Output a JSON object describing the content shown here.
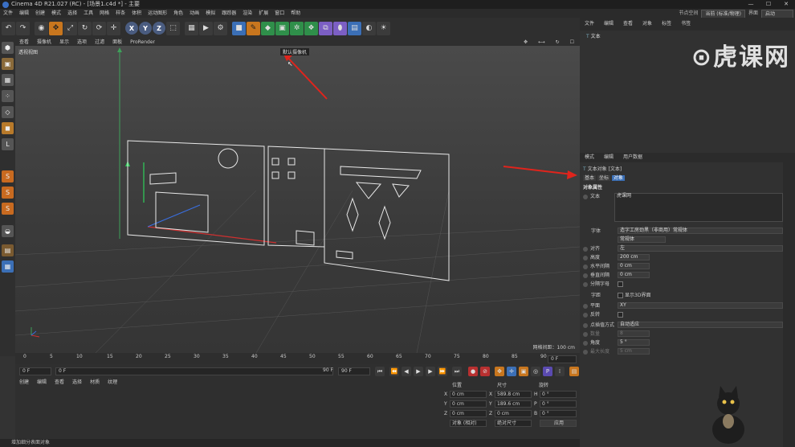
{
  "window": {
    "title": "Cinema 4D R21.027 (RC) - [场景1.c4d *] - 主要",
    "controls": [
      "—",
      "☐",
      "✕"
    ]
  },
  "menubar": [
    "文件",
    "编辑",
    "创建",
    "模式",
    "选择",
    "工具",
    "网格",
    "样条",
    "体积",
    "运动图形",
    "角色",
    "动画",
    "模拟",
    "跟踪器",
    "渲染",
    "扩展",
    "窗口",
    "帮助"
  ],
  "layout": {
    "label": "节点空间",
    "node_value": "当前 (标准/物理)",
    "interface_label": "界面",
    "interface_value": "启动"
  },
  "toolbar": {
    "icons": [
      "undo-icon",
      "redo-icon",
      "live-select-icon",
      "move-icon",
      "scale-icon",
      "rotate-icon",
      "recent-icon",
      "axis-icon",
      "x-axis-icon",
      "y-axis-icon",
      "z-axis-icon",
      "coord-system-icon",
      "render-view-icon",
      "render-icon",
      "render-settings-icon",
      "cube-icon",
      "pen-icon",
      "subdivision-icon",
      "extrude-icon",
      "cloner-icon",
      "mograph-icon",
      "deformer-icon",
      "tag-icon",
      "floor-icon",
      "camera-icon",
      "light-icon"
    ],
    "xyz": [
      "X",
      "Y",
      "Z"
    ]
  },
  "viewport": {
    "menu": [
      "查看",
      "摄像机",
      "显示",
      "选项",
      "过滤",
      "面板",
      "ProRender"
    ],
    "label": "透视视图",
    "camera_tip": "默认摄像机",
    "grid_info": "网格间距：100 cm"
  },
  "timeline": {
    "ticks": [
      "0",
      "5",
      "10",
      "15",
      "20",
      "25",
      "30",
      "35",
      "40",
      "45",
      "50",
      "55",
      "60",
      "65",
      "70",
      "75",
      "80",
      "85",
      "90"
    ],
    "end_label": "0 F"
  },
  "playback": {
    "start": "0 F",
    "current": "0 F",
    "range_end": "90 F",
    "end": "90 F"
  },
  "materials": {
    "menu": [
      "创建",
      "编辑",
      "查看",
      "选择",
      "材质",
      "纹理"
    ]
  },
  "coordinates": {
    "headers": [
      "位置",
      "尺寸",
      "旋转"
    ],
    "rows": [
      {
        "axis": "X",
        "pos": "0 cm",
        "size_axis": "X",
        "size": "589.8 cm",
        "rot_axis": "H",
        "rot": "0 °"
      },
      {
        "axis": "Y",
        "pos": "0 cm",
        "size_axis": "Y",
        "size": "189.6 cm",
        "rot_axis": "P",
        "rot": "0 °"
      },
      {
        "axis": "Z",
        "pos": "0 cm",
        "size_axis": "Z",
        "size": "0 cm",
        "rot_axis": "B",
        "rot": "0 °"
      }
    ],
    "mode": "对象 (相对)",
    "size_mode": "绝对尺寸",
    "apply": "应用"
  },
  "status": "增加细分表面对象",
  "objects": {
    "tabs": [
      "文件",
      "编辑",
      "查看",
      "对象",
      "标签",
      "书签"
    ],
    "item": "文本"
  },
  "attributes": {
    "menu": [
      "模式",
      "编辑",
      "用户数据"
    ],
    "object_title": "文本对象 [文本]",
    "tabs": [
      "基本",
      "坐标",
      "对象"
    ],
    "section": "对象属性",
    "text_label": "文本",
    "text_value": "虎课网",
    "font_label": "字体",
    "font_value": "造字工房劲黑（非商用）常规体",
    "font_style": "常规体",
    "align_label": "对齐",
    "align_value": "左",
    "height_label": "高度",
    "height_value": "200 cm",
    "hspace_label": "水平间隔",
    "hspace_value": "0 cm",
    "vspace_label": "垂直间隔",
    "vspace_value": "0 cm",
    "kerning_label": "分隔字母",
    "glyph_label": "字距",
    "show3d_label": "显示3D界面",
    "plane_label": "平面",
    "plane_value": "XY",
    "reverse_label": "反转",
    "interp_label": "点插值方式",
    "interp_value": "自动适应",
    "number_label": "数量",
    "number_value": "8",
    "angle_label": "角度",
    "angle_value": "5 °",
    "maxlen_label": "最大长度",
    "maxlen_value": "5 cm"
  },
  "watermark": "虎课网",
  "colors": {
    "accent": "#c8761e",
    "arrow": "#e0241c",
    "text_outline": "#e8e8e8"
  }
}
